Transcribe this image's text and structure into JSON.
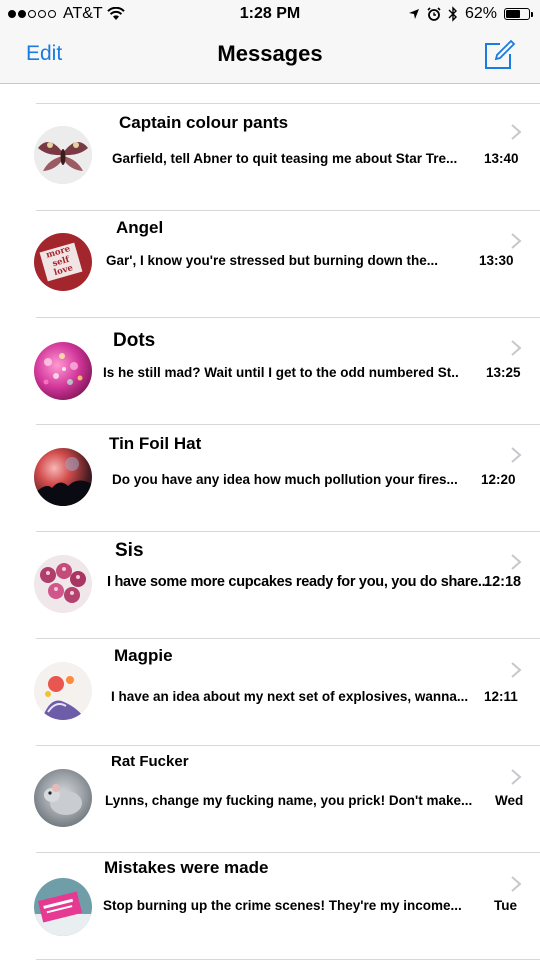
{
  "status_bar": {
    "carrier": "AT&T",
    "time": "1:28 PM",
    "battery_percent": "62%",
    "battery_level": 0.62,
    "signal_icon": "signal-dots-icon",
    "wifi_icon": "wifi-icon"
  },
  "nav": {
    "edit_label": "Edit",
    "title": "Messages",
    "compose_icon": "compose-icon"
  },
  "colors": {
    "accent": "#1a7be0",
    "separator": "#d8d8dc",
    "bar": "#f7f7f7"
  },
  "conversations": [
    {
      "name": "Captain colour pants",
      "preview": "Garfield, tell Abner to quit teasing me about Star Tre...",
      "time": "13:40"
    },
    {
      "name": "Angel",
      "preview": "Gar', I know you're stressed but burning down the...",
      "time": "13:30"
    },
    {
      "name": "Dots",
      "preview": "Is he still mad? Wait until I get to the odd numbered St..",
      "time": "13:25"
    },
    {
      "name": "Tin Foil Hat",
      "preview": "Do you have any idea how much pollution your fires...",
      "time": "12:20"
    },
    {
      "name": "Sis",
      "preview": "I have some more cupcakes ready for you, you do share...",
      "time": "12:18"
    },
    {
      "name": "Magpie",
      "preview": "I have an idea about my next set of explosives, wanna...",
      "time": "12:11"
    },
    {
      "name": "Rat Fucker",
      "preview": "Lynns, change my fucking name, you prick! Don't make...",
      "time": "Wed"
    },
    {
      "name": "Mistakes were made",
      "preview": "Stop burning up the crime scenes! They're my income...",
      "time": "Tue"
    }
  ],
  "avatar_texts": {
    "angel_sticker": "more self love"
  }
}
